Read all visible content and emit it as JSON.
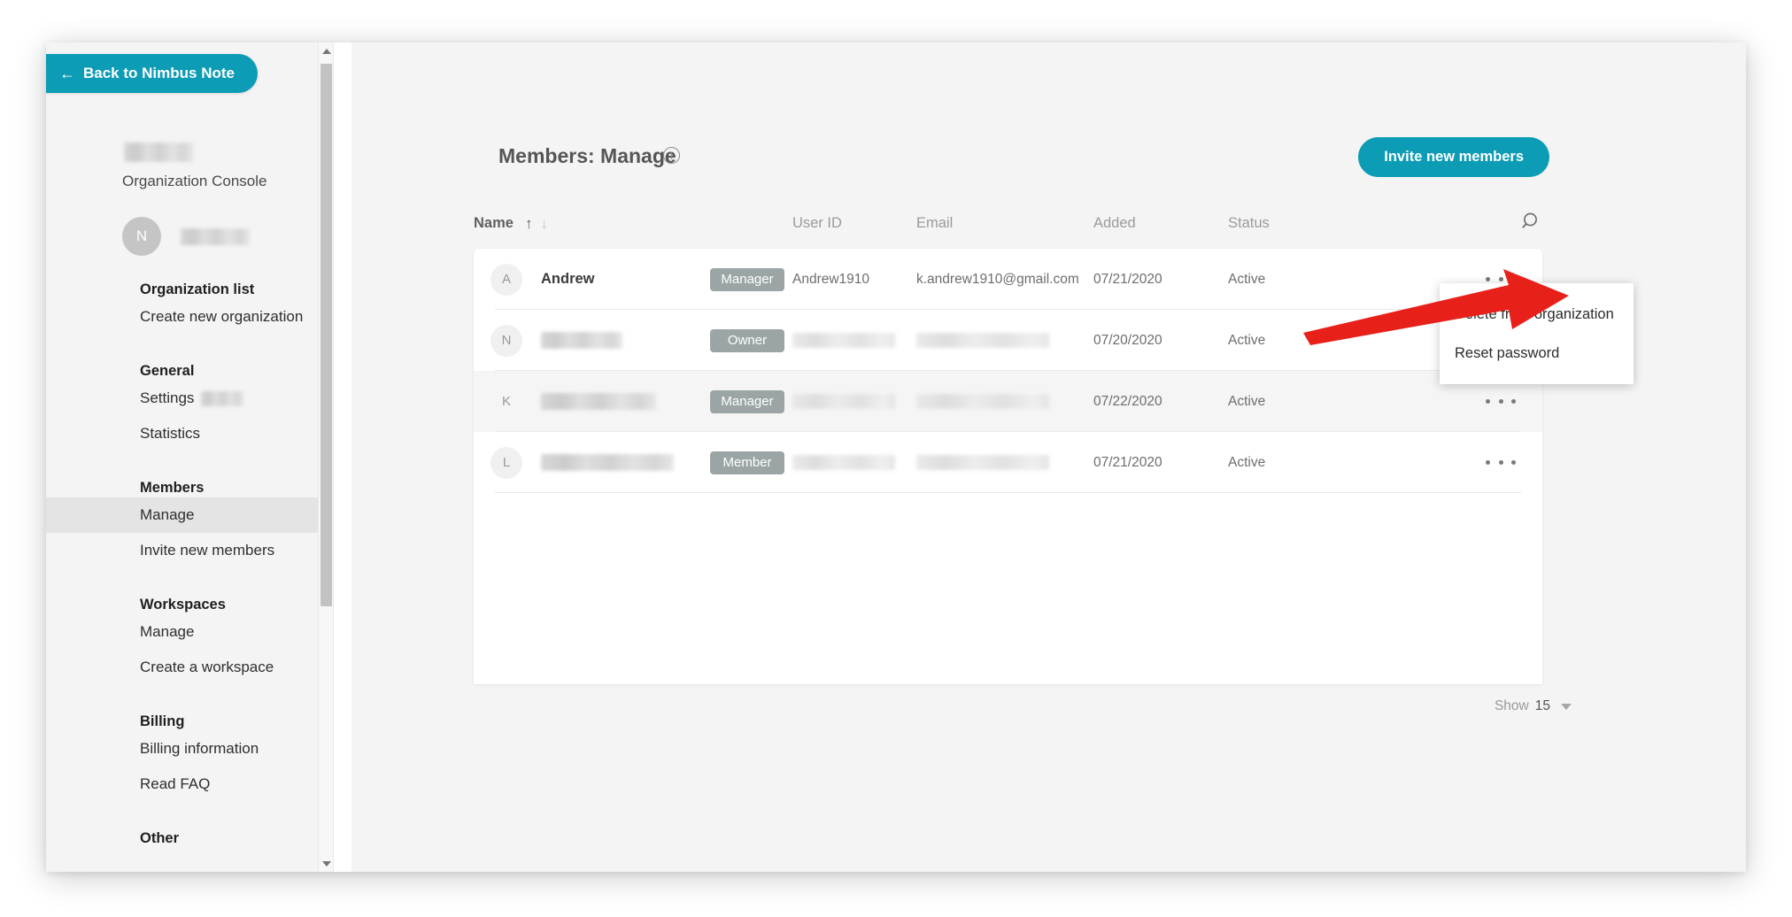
{
  "sidebar": {
    "back_label": "Back to Nimbus Note",
    "back_arrow": "←",
    "org_console_label": "Organization Console",
    "user_initial": "N",
    "sections": [
      {
        "heading": "Organization list",
        "items": [
          {
            "label": "Create new organization",
            "active": false,
            "redacted_suffix": false
          }
        ]
      },
      {
        "heading": "General",
        "items": [
          {
            "label": "Settings",
            "active": false,
            "redacted_suffix": true
          },
          {
            "label": "Statistics",
            "active": false,
            "redacted_suffix": false
          }
        ]
      },
      {
        "heading": "Members",
        "items": [
          {
            "label": "Manage",
            "active": true,
            "redacted_suffix": false
          },
          {
            "label": "Invite new members",
            "active": false,
            "redacted_suffix": false
          }
        ]
      },
      {
        "heading": "Workspaces",
        "items": [
          {
            "label": "Manage",
            "active": false,
            "redacted_suffix": false
          },
          {
            "label": "Create a workspace",
            "active": false,
            "redacted_suffix": false
          }
        ]
      },
      {
        "heading": "Billing",
        "items": [
          {
            "label": "Billing information",
            "active": false,
            "redacted_suffix": false
          },
          {
            "label": "Read FAQ",
            "active": false,
            "redacted_suffix": false
          }
        ]
      },
      {
        "heading": "Other",
        "items": []
      }
    ]
  },
  "header": {
    "title": "Members: Manage",
    "info_glyph": "i",
    "invite_button_label": "Invite new members"
  },
  "table": {
    "columns": [
      {
        "key": "name",
        "label": "Name"
      },
      {
        "key": "user_id",
        "label": "User ID"
      },
      {
        "key": "email",
        "label": "Email"
      },
      {
        "key": "added",
        "label": "Added"
      },
      {
        "key": "status",
        "label": "Status"
      }
    ],
    "sort": {
      "asc_glyph": "↑",
      "desc_glyph": "↓",
      "active": "asc"
    },
    "search_icon": "search-icon",
    "rows": [
      {
        "avatar_initial": "A",
        "avatar_visible": true,
        "name": "Andrew",
        "name_redacted": false,
        "role": "Manager",
        "user_id": "Andrew1910",
        "user_id_redacted": false,
        "email": "k.andrew1910@gmail.com",
        "email_redacted": false,
        "added": "07/21/2020",
        "status": "Active",
        "hovered": false
      },
      {
        "avatar_initial": "N",
        "avatar_visible": true,
        "name": "",
        "name_redacted": true,
        "role": "Owner",
        "user_id": "",
        "user_id_redacted": true,
        "email": "",
        "email_redacted": true,
        "added": "07/20/2020",
        "status": "Active",
        "hovered": false
      },
      {
        "avatar_initial": "K",
        "avatar_visible": false,
        "name": "",
        "name_redacted": true,
        "role": "Manager",
        "user_id": "",
        "user_id_redacted": true,
        "email": "",
        "email_redacted": true,
        "added": "07/22/2020",
        "status": "Active",
        "hovered": true
      },
      {
        "avatar_initial": "L",
        "avatar_visible": true,
        "name": "",
        "name_redacted": true,
        "role": "Member",
        "user_id": "",
        "user_id_redacted": true,
        "email": "",
        "email_redacted": true,
        "added": "07/21/2020",
        "status": "Active",
        "hovered": false
      }
    ]
  },
  "context_menu": {
    "items": [
      {
        "label": "Delete from organization"
      },
      {
        "label": "Reset password"
      }
    ]
  },
  "footer": {
    "show_label": "Show",
    "show_count": "15"
  },
  "annotation": {
    "arrow_color": "#e8201a"
  },
  "colors": {
    "accent": "#0d9cb5",
    "badge": "#9ba5a5",
    "page_bg": "#f4f4f4",
    "card_bg": "#ffffff",
    "row_hover": "#f5f5f5",
    "arrow_red": "#e8201a"
  }
}
